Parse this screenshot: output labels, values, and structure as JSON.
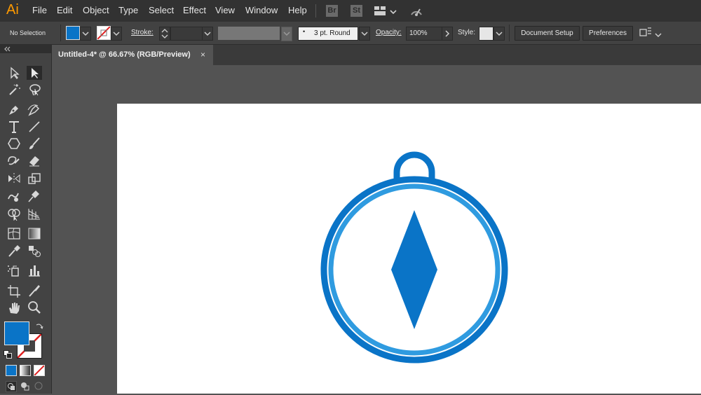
{
  "app": {
    "logo": "Ai",
    "menu": [
      "File",
      "Edit",
      "Object",
      "Type",
      "Select",
      "Effect",
      "View",
      "Window",
      "Help"
    ],
    "bridge": "Br",
    "stock": "St"
  },
  "control_bar": {
    "selection": "No Selection",
    "stroke_label": "Stroke:",
    "brush_value": "3 pt. Round",
    "opacity_label": "Opacity:",
    "opacity_value": "100%",
    "style_label": "Style:",
    "document_setup": "Document Setup",
    "preferences": "Preferences"
  },
  "document_tab": {
    "title": "Untitled-4* @ 66.67% (RGB/Preview)",
    "close": "×"
  },
  "colors": {
    "fill": "#0a74c7",
    "compass_outer": "#0a74c7",
    "compass_inner_ring": "#2f9be0",
    "artboard": "#ffffff"
  }
}
